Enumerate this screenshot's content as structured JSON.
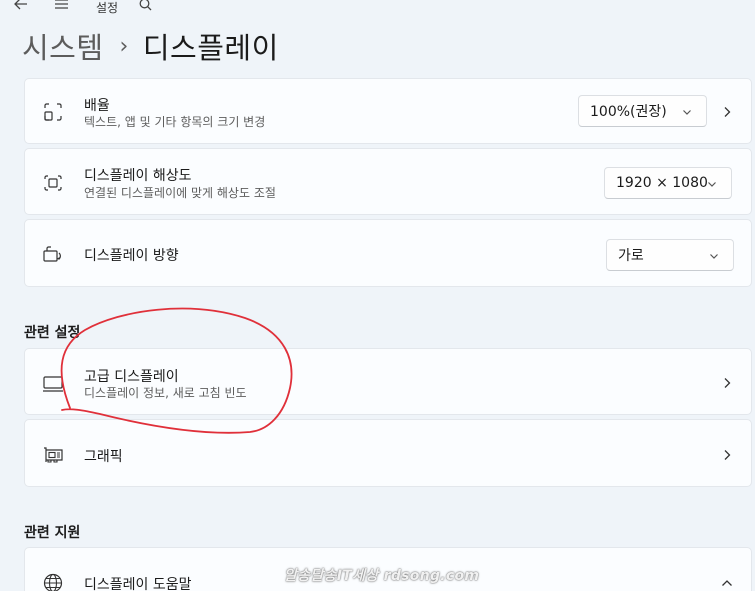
{
  "topbar": {
    "title": "설정"
  },
  "breadcrumb": {
    "parent": "시스템",
    "separator": "›",
    "current": "디스플레이"
  },
  "settings": {
    "scale": {
      "label": "배율",
      "desc": "텍스트, 앱 및 기타 항목의 크기 변경",
      "value": "100%(권장)"
    },
    "resolution": {
      "label": "디스플레이 해상도",
      "desc": "연결된 디스플레이에 맞게 해상도 조절",
      "value": "1920 × 1080"
    },
    "orientation": {
      "label": "디스플레이 방향",
      "value": "가로"
    }
  },
  "related_settings": {
    "heading": "관련 설정",
    "advanced": {
      "label": "고급 디스플레이",
      "desc": "디스플레이 정보, 새로 고침 빈도"
    },
    "graphics": {
      "label": "그래픽"
    }
  },
  "related_support": {
    "heading": "관련 지원",
    "help": {
      "label": "디스플레이 도움말"
    }
  },
  "watermark": "알송달송IT세상 rdsong.com",
  "colors": {
    "background": "#eff4f9",
    "card": "#fbfdff",
    "annotation": "#e0303a"
  },
  "annotation": "red hand-drawn circle around 고급 디스플레이"
}
